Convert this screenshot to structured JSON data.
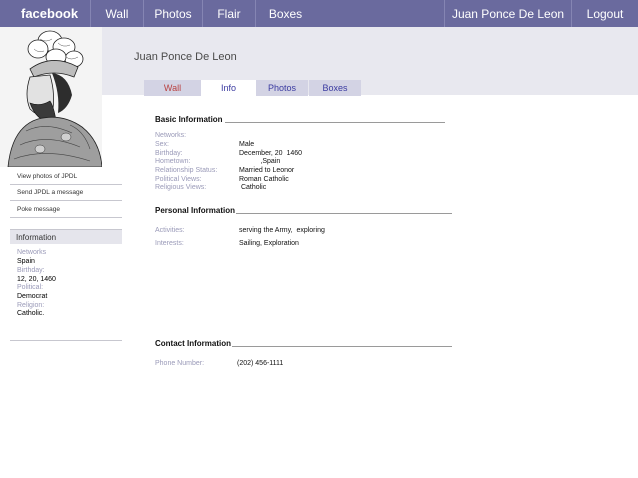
{
  "topbar": {
    "logo": "facebook",
    "nav": [
      "Wall",
      "Photos",
      "Flair",
      "Boxes"
    ],
    "user": "Juan Ponce De Leon",
    "logout": "Logout"
  },
  "profile": {
    "name": "Juan Ponce De Leon"
  },
  "tabs": [
    "Wall",
    "Info",
    "Photos",
    "Boxes"
  ],
  "sidebar": {
    "links": [
      "View photos of JPDL",
      "Send JPDL  a message",
      "Poke message"
    ],
    "info_title": "Information",
    "info": [
      {
        "label": "Networks",
        "value": "Spain"
      },
      {
        "label": "Birthday:",
        "value": "12, 20, 1460"
      },
      {
        "label": "Political:",
        "value": "Democrat"
      },
      {
        "label": "Religion:",
        "value": "Catholic."
      }
    ]
  },
  "basic": {
    "title": "Basic Information",
    "fields": [
      {
        "label": "Networks:",
        "value": ""
      },
      {
        "label": "Sex:",
        "value": "Male"
      },
      {
        "label": "Birthday:",
        "value": "December, 20  1460"
      },
      {
        "label": "Hometown:",
        "value": "           ,Spain"
      },
      {
        "label": "Relationship Status:",
        "value": "Married to Leonor"
      },
      {
        "label": "Political Views:",
        "value": "Roman Catholic"
      },
      {
        "label": "Religious Views:",
        "value": " Catholic"
      }
    ]
  },
  "personal": {
    "title": "Personal Information",
    "fields": [
      {
        "label": "Activities:",
        "value": "serving the Army,  exploring"
      },
      {
        "label": "Interests:",
        "value": "Sailing, Exploration"
      }
    ]
  },
  "contact": {
    "title": "Contact Information",
    "fields": [
      {
        "label": "Phone Number:",
        "value": "(202) 456-1111"
      }
    ]
  },
  "colors": {
    "topbar": "#6a6a9e",
    "header_band": "#e8e8ef",
    "tab_bg": "#d3d3e4",
    "label": "#9a9ab8"
  }
}
